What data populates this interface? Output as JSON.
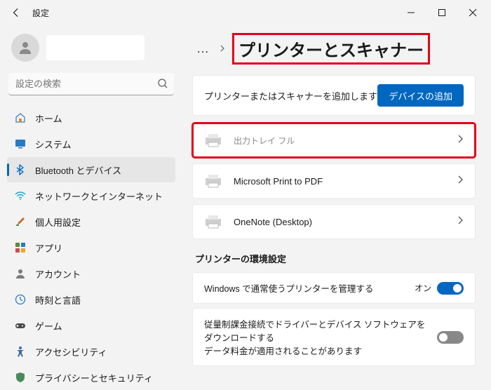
{
  "titlebar": {
    "title": "設定"
  },
  "search": {
    "placeholder": "設定の検索"
  },
  "nav": {
    "items": [
      {
        "label": "ホーム"
      },
      {
        "label": "システム"
      },
      {
        "label": "Bluetooth とデバイス"
      },
      {
        "label": "ネットワークとインターネット"
      },
      {
        "label": "個人用設定"
      },
      {
        "label": "アプリ"
      },
      {
        "label": "アカウント"
      },
      {
        "label": "時刻と言語"
      },
      {
        "label": "ゲーム"
      },
      {
        "label": "アクセシビリティ"
      },
      {
        "label": "プライバシーとセキュリティ"
      }
    ]
  },
  "crumbs": {
    "dots": "…"
  },
  "page": {
    "title": "プリンターとスキャナー"
  },
  "add": {
    "label": "プリンターまたはスキャナーを追加します",
    "button": "デバイスの追加"
  },
  "printers": [
    {
      "name": "",
      "status": "出力トレイ フル"
    },
    {
      "name": "Microsoft Print to PDF",
      "status": ""
    },
    {
      "name": "OneNote (Desktop)",
      "status": ""
    }
  ],
  "prefs": {
    "heading": "プリンターの環境設定",
    "default": {
      "label": "Windows で通常使うプリンターを管理する",
      "state_label": "オン",
      "on": true
    },
    "metered": {
      "label": "従量制課金接続でドライバーとデバイス ソフトウェアをダウンロードする",
      "sub": "データ料金が適用されることがあります",
      "on": false
    }
  }
}
